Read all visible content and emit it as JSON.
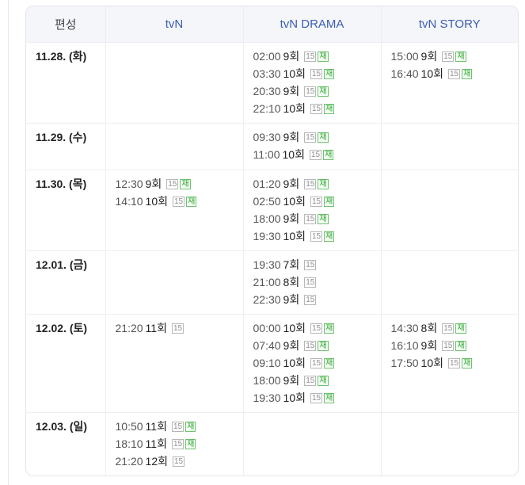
{
  "header": {
    "date_col": "편성",
    "channels": [
      "tvN",
      "tvN DRAMA",
      "tvN STORY"
    ]
  },
  "badges": {
    "age": "15",
    "rerun": "재"
  },
  "colors": {
    "header_bg": "#f5f6f9",
    "channel_text": "#3b5db3",
    "rerun_badge": "#2fa12f"
  },
  "rows": [
    {
      "date": "11.28. (화)",
      "cells": [
        [],
        [
          {
            "time": "02:00",
            "ep": "9회",
            "rerun": true
          },
          {
            "time": "03:30",
            "ep": "10회",
            "rerun": true
          },
          {
            "time": "20:30",
            "ep": "9회",
            "rerun": true
          },
          {
            "time": "22:10",
            "ep": "10회",
            "rerun": true
          }
        ],
        [
          {
            "time": "15:00",
            "ep": "9회",
            "rerun": true
          },
          {
            "time": "16:40",
            "ep": "10회",
            "rerun": true
          }
        ]
      ]
    },
    {
      "date": "11.29. (수)",
      "cells": [
        [],
        [
          {
            "time": "09:30",
            "ep": "9회",
            "rerun": true
          },
          {
            "time": "11:00",
            "ep": "10회",
            "rerun": true
          }
        ],
        []
      ]
    },
    {
      "date": "11.30. (목)",
      "cells": [
        [
          {
            "time": "12:30",
            "ep": "9회",
            "rerun": true
          },
          {
            "time": "14:10",
            "ep": "10회",
            "rerun": true
          }
        ],
        [
          {
            "time": "01:20",
            "ep": "9회",
            "rerun": true
          },
          {
            "time": "02:50",
            "ep": "10회",
            "rerun": true
          },
          {
            "time": "18:00",
            "ep": "9회",
            "rerun": true
          },
          {
            "time": "19:30",
            "ep": "10회",
            "rerun": true
          }
        ],
        []
      ]
    },
    {
      "date": "12.01. (금)",
      "cells": [
        [],
        [
          {
            "time": "19:30",
            "ep": "7회",
            "rerun": false
          },
          {
            "time": "21:00",
            "ep": "8회",
            "rerun": false
          },
          {
            "time": "22:30",
            "ep": "9회",
            "rerun": false
          }
        ],
        []
      ]
    },
    {
      "date": "12.02. (토)",
      "cells": [
        [
          {
            "time": "21:20",
            "ep": "11회",
            "rerun": false
          }
        ],
        [
          {
            "time": "00:00",
            "ep": "10회",
            "rerun": true
          },
          {
            "time": "07:40",
            "ep": "9회",
            "rerun": true
          },
          {
            "time": "09:10",
            "ep": "10회",
            "rerun": true
          },
          {
            "time": "18:00",
            "ep": "9회",
            "rerun": true
          },
          {
            "time": "19:30",
            "ep": "10회",
            "rerun": true
          }
        ],
        [
          {
            "time": "14:30",
            "ep": "8회",
            "rerun": true
          },
          {
            "time": "16:10",
            "ep": "9회",
            "rerun": true
          },
          {
            "time": "17:50",
            "ep": "10회",
            "rerun": true
          }
        ]
      ]
    },
    {
      "date": "12.03. (일)",
      "cells": [
        [
          {
            "time": "10:50",
            "ep": "11회",
            "rerun": true
          },
          {
            "time": "18:10",
            "ep": "11회",
            "rerun": true
          },
          {
            "time": "21:20",
            "ep": "12회",
            "rerun": false
          }
        ],
        [],
        []
      ]
    }
  ]
}
